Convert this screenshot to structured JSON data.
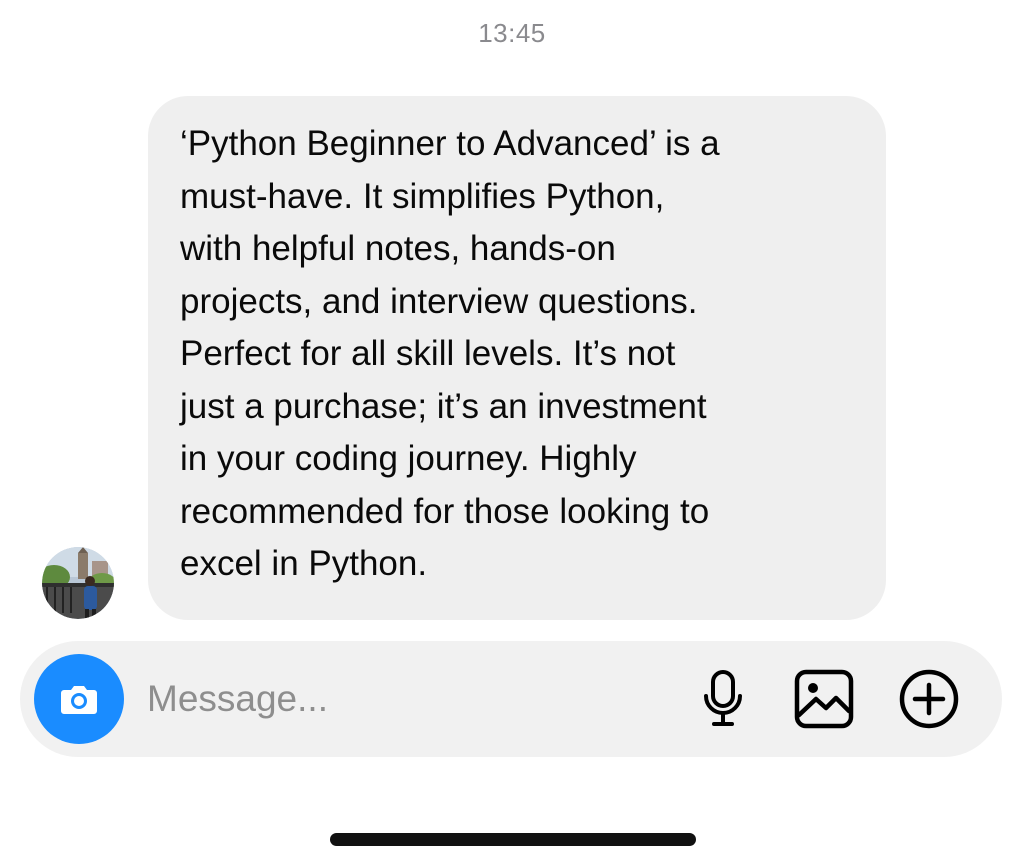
{
  "status": {
    "time": "13:45"
  },
  "conversation": {
    "messages": [
      {
        "text": "‘Python Beginner to Advanced’ is a\nmust-have. It simplifies Python,\nwith helpful notes, hands-on\nprojects, and interview questions.\nPerfect for all skill levels. It’s not\njust a purchase; it’s an investment\nin your coding journey. Highly\nrecommended for those looking to\nexcel in Python.",
        "bubble_color": "#efefef",
        "avatar_icon": "avatar-photo"
      }
    ]
  },
  "composer": {
    "placeholder": "Message...",
    "value": "",
    "camera_icon": "camera-icon",
    "camera_color": "#1a8cff",
    "mic_icon": "microphone-icon",
    "gallery_icon": "gallery-icon",
    "plus_icon": "plus-circle-icon"
  },
  "colors": {
    "accent": "#1a8cff",
    "timestamp": "#8a8a8e",
    "composer_bg": "#f1f1f1"
  }
}
